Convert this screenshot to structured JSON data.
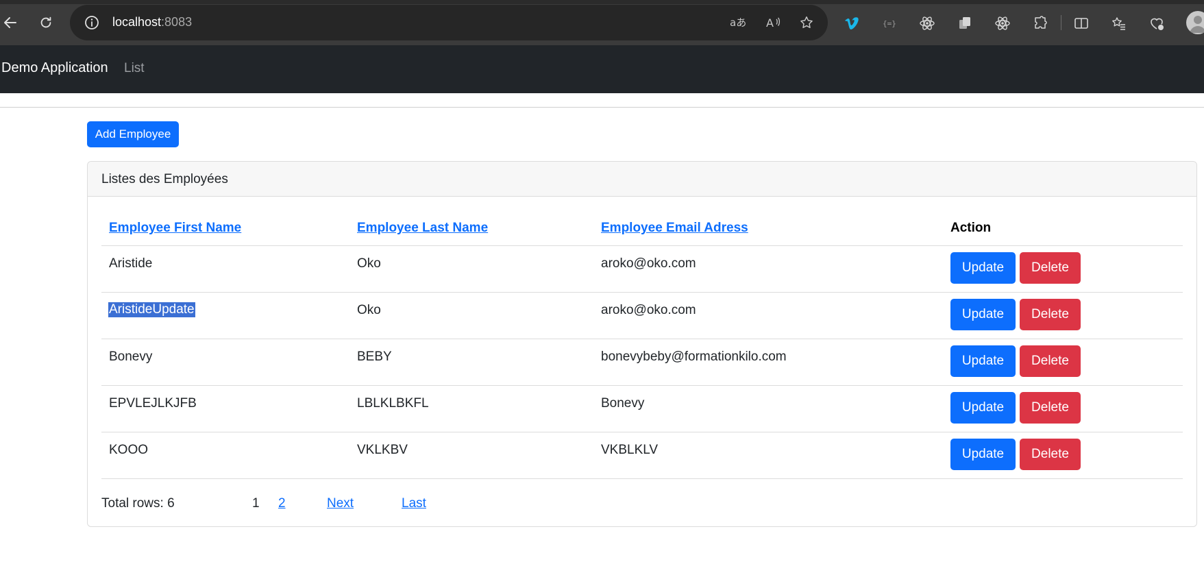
{
  "browser": {
    "host": "localhost",
    "port": ":8083"
  },
  "navbar": {
    "brand": "Demo Application",
    "link_list": "List"
  },
  "add_button_label": "Add Employee",
  "card": {
    "title": "Listes des Employées",
    "columns": {
      "first_name": "Employee First Name",
      "last_name": "Employee Last Name",
      "email": "Employee Email Adress",
      "action": "Action"
    },
    "rows": [
      {
        "first": "Aristide",
        "last": "Oko",
        "email": "aroko@oko.com",
        "update": "Update",
        "delete": "Delete"
      },
      {
        "first": "AristideUpdate",
        "last": "Oko",
        "email": "aroko@oko.com",
        "update": "Update",
        "delete": "Delete"
      },
      {
        "first": "Bonevy",
        "last": "BEBY",
        "email": "bonevybeby@formationkilo.com",
        "update": "Update",
        "delete": "Delete"
      },
      {
        "first": "EPVLEJLKJFB",
        "last": "LBLKLBKFL",
        "email": "Bonevy",
        "update": "Update",
        "delete": "Delete"
      },
      {
        "first": "KOOO",
        "last": "VKLKBV",
        "email": "VKBLKLV",
        "update": "Update",
        "delete": "Delete"
      }
    ],
    "footer": {
      "total_rows": "Total rows: 6",
      "current_page": "1",
      "page_2": "2",
      "next": "Next",
      "last": "Last"
    }
  },
  "colors": {
    "primary": "#0d6efd",
    "danger": "#dc3545",
    "navbar": "#212529",
    "browser_chrome": "#3b3b3b",
    "selection": "#3b6fd4"
  },
  "icons": {
    "back": "back-arrow-icon",
    "refresh": "refresh-icon",
    "info": "info-icon",
    "translate": "translate-icon",
    "read_aloud": "read-aloud-icon",
    "favorite": "star-icon",
    "extensions": [
      "vimeo-icon",
      "bracket-extension-icon",
      "react-devtools-icon",
      "copy-extension-icon",
      "react-icon",
      "puzzle-extensions-icon",
      "split-screen-icon",
      "favorites-icon",
      "browser-essentials-icon"
    ],
    "profile": "profile-avatar-icon"
  }
}
